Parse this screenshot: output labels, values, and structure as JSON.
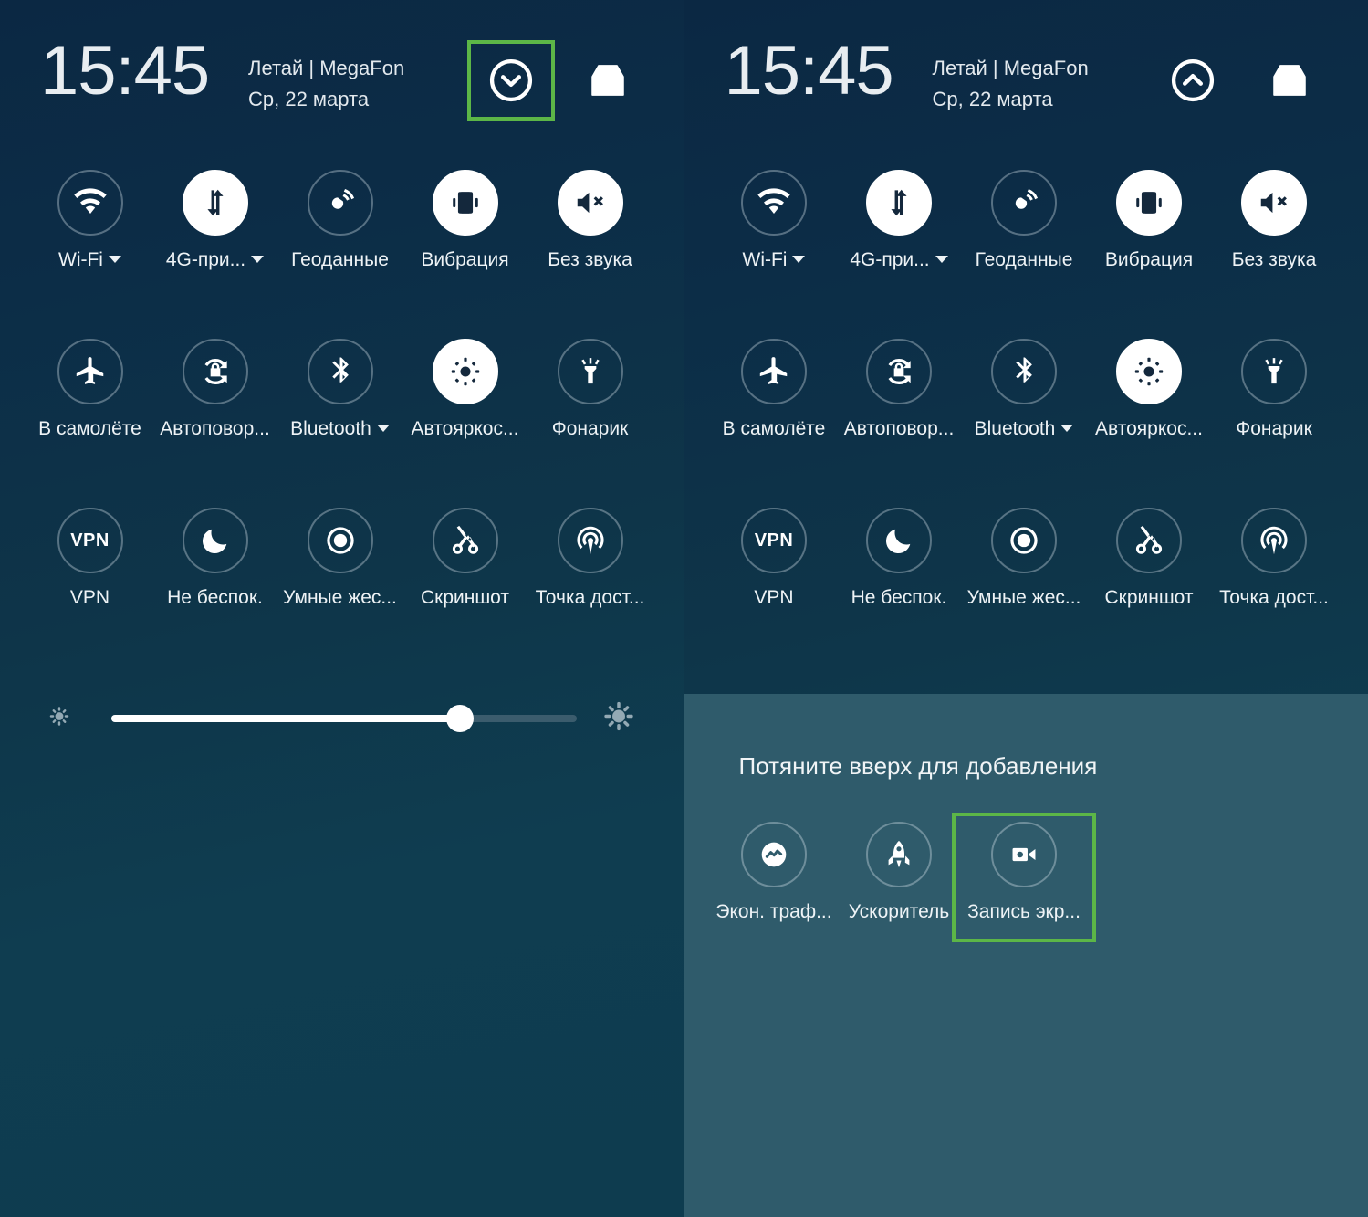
{
  "meta": {
    "accent_green": "#5cb647",
    "panel_bg_top": "#0b2843",
    "panel_bg_bottom": "#0e3c4f",
    "drawer_bg": "#2f5b6b"
  },
  "left_panel": {
    "header": {
      "time": "15:45",
      "carrier": "Летай | MegaFon",
      "date": "Ср, 22 марта",
      "chevron_icon": "chevron-down-circle-icon",
      "chevron_highlighted": true,
      "inbox_icon": "inbox-icon"
    },
    "rows": [
      [
        {
          "label": "Wi-Fi",
          "icon": "wifi-icon",
          "on": false,
          "caret": true
        },
        {
          "label": "4G-при...",
          "icon": "data-transfer-icon",
          "on": true,
          "caret": true
        },
        {
          "label": "Геоданные",
          "icon": "location-tap-icon",
          "on": false,
          "caret": false
        },
        {
          "label": "Вибрация",
          "icon": "vibration-icon",
          "on": true,
          "caret": false
        },
        {
          "label": "Без звука",
          "icon": "mute-icon",
          "on": true,
          "caret": false
        }
      ],
      [
        {
          "label": "В самолёте",
          "icon": "airplane-icon",
          "on": false,
          "caret": false
        },
        {
          "label": "Автоповор...",
          "icon": "auto-rotate-icon",
          "on": false,
          "caret": false
        },
        {
          "label": "Bluetooth",
          "icon": "bluetooth-icon",
          "on": false,
          "caret": true
        },
        {
          "label": "Автояркос...",
          "icon": "auto-brightness-icon",
          "on": true,
          "caret": false
        },
        {
          "label": "Фонарик",
          "icon": "flashlight-icon",
          "on": false,
          "caret": false
        }
      ],
      [
        {
          "label": "VPN",
          "icon": "vpn-icon",
          "on": false,
          "caret": false
        },
        {
          "label": "Не беспок.",
          "icon": "moon-icon",
          "on": false,
          "caret": false
        },
        {
          "label": "Умные жес...",
          "icon": "smart-gestures-icon",
          "on": false,
          "caret": false
        },
        {
          "label": "Скриншот",
          "icon": "scissors-icon",
          "on": false,
          "caret": false
        },
        {
          "label": "Точка дост...",
          "icon": "hotspot-icon",
          "on": false,
          "caret": false
        }
      ]
    ],
    "brightness": {
      "low_icon": "brightness-low-icon",
      "high_icon": "brightness-high-icon",
      "value_percent": 75
    }
  },
  "right_panel": {
    "header": {
      "time": "15:45",
      "carrier": "Летай | MegaFon",
      "date": "Ср, 22 марта",
      "chevron_icon": "chevron-up-circle-icon",
      "chevron_highlighted": false,
      "inbox_icon": "inbox-icon"
    },
    "rows": [
      [
        {
          "label": "Wi-Fi",
          "icon": "wifi-icon",
          "on": false,
          "caret": true
        },
        {
          "label": "4G-при...",
          "icon": "data-transfer-icon",
          "on": true,
          "caret": true
        },
        {
          "label": "Геоданные",
          "icon": "location-tap-icon",
          "on": false,
          "caret": false
        },
        {
          "label": "Вибрация",
          "icon": "vibration-icon",
          "on": true,
          "caret": false
        },
        {
          "label": "Без звука",
          "icon": "mute-icon",
          "on": true,
          "caret": false
        }
      ],
      [
        {
          "label": "В самолёте",
          "icon": "airplane-icon",
          "on": false,
          "caret": false
        },
        {
          "label": "Автоповор...",
          "icon": "auto-rotate-icon",
          "on": false,
          "caret": false
        },
        {
          "label": "Bluetooth",
          "icon": "bluetooth-icon",
          "on": false,
          "caret": true
        },
        {
          "label": "Автояркос...",
          "icon": "auto-brightness-icon",
          "on": true,
          "caret": false
        },
        {
          "label": "Фонарик",
          "icon": "flashlight-icon",
          "on": false,
          "caret": false
        }
      ],
      [
        {
          "label": "VPN",
          "icon": "vpn-icon",
          "on": false,
          "caret": false
        },
        {
          "label": "Не беспок.",
          "icon": "moon-icon",
          "on": false,
          "caret": false
        },
        {
          "label": "Умные жес...",
          "icon": "smart-gestures-icon",
          "on": false,
          "caret": false
        },
        {
          "label": "Скриншот",
          "icon": "scissors-icon",
          "on": false,
          "caret": false
        },
        {
          "label": "Точка дост...",
          "icon": "hotspot-icon",
          "on": false,
          "caret": false
        }
      ]
    ],
    "drawer": {
      "title": "Потяните вверх для добавления",
      "tiles": [
        {
          "label": "Экон. траф...",
          "icon": "data-saver-icon",
          "highlighted": false
        },
        {
          "label": "Ускоритель",
          "icon": "rocket-icon",
          "highlighted": false
        },
        {
          "label": "Запись экр...",
          "icon": "screen-record-icon",
          "highlighted": true
        }
      ]
    }
  }
}
